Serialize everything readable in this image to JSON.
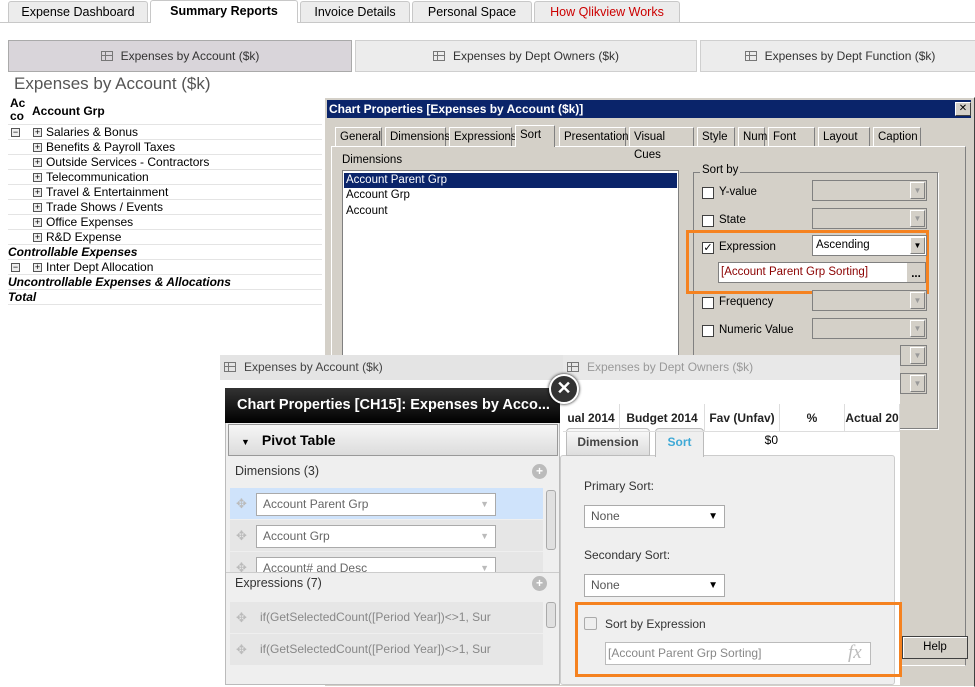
{
  "top_tabs": [
    {
      "label": "Expense Dashboard"
    },
    {
      "label": "Summary Reports",
      "active": true
    },
    {
      "label": "Invoice Details"
    },
    {
      "label": "Personal Space"
    },
    {
      "label": "How Qlikview Works",
      "color": "#cc0000"
    }
  ],
  "sheet_buttons": [
    {
      "label": "Expenses by Account ($k)",
      "active": true
    },
    {
      "label": "Expenses by Dept Owners ($k)"
    },
    {
      "label": "Expenses by Dept Function ($k)"
    }
  ],
  "page_title": "Expenses by Account ($k)",
  "pivot": {
    "col1_header": "Ac co",
    "col2_header": "Account Grp",
    "rows": [
      "Salaries & Bonus",
      "Benefits & Payroll Taxes",
      "Outside Services - Contractors",
      "Telecommunication",
      "Travel & Entertainment",
      "Trade Shows / Events",
      "Office Expenses",
      "R&D Expense"
    ],
    "subtotal1": "Controllable Expenses",
    "row_alloc": "Inter Dept Allocation",
    "subtotal2": "Uncontrollable Expenses & Allocations",
    "total": "Total"
  },
  "old_dialog": {
    "title": "Chart Properties [Expenses by Account ($k)]",
    "close": "✕",
    "tabs": [
      "General",
      "Dimensions",
      "Expressions",
      "Sort",
      "Presentation",
      "Visual Cues",
      "Style",
      "Number",
      "Font",
      "Layout",
      "Caption"
    ],
    "dimensions_label": "Dimensions",
    "dimensions": [
      "Account Parent Grp",
      "Account Grp",
      "Account"
    ],
    "sort_by_label": "Sort by",
    "options": [
      {
        "label": "Y-value",
        "checked": false
      },
      {
        "label": "State",
        "checked": false
      },
      {
        "label": "Expression",
        "checked": true,
        "value": "Ascending"
      },
      {
        "label": "Frequency",
        "checked": false
      },
      {
        "label": "Numeric Value",
        "checked": false
      }
    ],
    "expression_value": "[Account Parent Grp Sorting]",
    "ellipsis": "...",
    "help": "Help"
  },
  "new_view": {
    "strip_left": "Expenses by Account ($k)",
    "strip_right": "Expenses by Dept Owners ($k)",
    "table_headers": [
      "ual 2014",
      "Budget 2014",
      "Fav (Unfav)",
      "%",
      "Actual 20"
    ],
    "cell_values": [
      "$0"
    ],
    "dialog_title": "Chart Properties [CH15]: Expenses by Acco...",
    "section": "Pivot Table",
    "dimensions_label": "Dimensions  (3)",
    "dimensions": [
      "Account Parent Grp",
      "Account Grp",
      "Account# and Desc"
    ],
    "expressions_label": "Expressions  (7)",
    "expressions": [
      "if(GetSelectedCount([Period Year])<>1, Sur",
      "if(GetSelectedCount([Period Year])<>1, Sur"
    ],
    "tabs": [
      "Dimension",
      "Sort"
    ],
    "primary_sort_label": "Primary Sort:",
    "primary_sort": "None",
    "secondary_sort_label": "Secondary Sort:",
    "secondary_sort": "None",
    "sort_by_expression": "Sort by Expression",
    "expression_value": "[Account Parent Grp Sorting]",
    "fx": "fx"
  },
  "colors": {
    "highlight": "#f58220",
    "old_title": "#0a246a",
    "new_accent": "#3fa9d6"
  }
}
